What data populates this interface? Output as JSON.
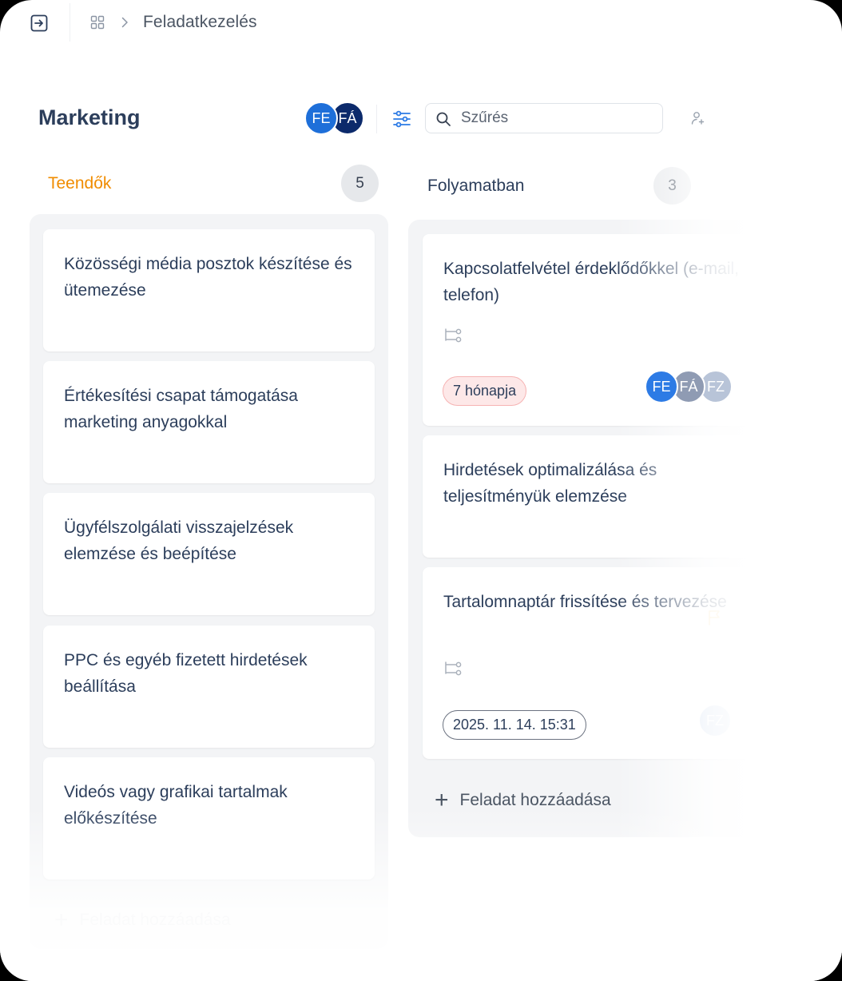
{
  "breadcrumb": {
    "current": "Feladatkezelés"
  },
  "board": {
    "title": "Marketing",
    "members": [
      "FE",
      "FÁ"
    ],
    "search_placeholder": "Szűrés"
  },
  "columns": {
    "todo": {
      "title": "Teendők",
      "count": "5",
      "cards": [
        {
          "title": "Közösségi média posztok készítése és ütemezése"
        },
        {
          "title": "Értékesítési csapat támogatása marketing anyagokkal"
        },
        {
          "title": "Ügyfélszolgálati visszajelzések elemzése és beépítése"
        },
        {
          "title": "PPC és egyéb fizetett hirdetések beállítása"
        },
        {
          "title": "Videós vagy grafikai tartalmak előkészítése"
        }
      ],
      "add_label": "Feladat hozzáadása"
    },
    "in_progress": {
      "title": "Folyamatban",
      "count": "3",
      "cards": [
        {
          "title": "Kapcsolatfelvétel érdeklődőkkel (e-mail, telefon)",
          "tag": "7 hónapja",
          "assignees": [
            "FE",
            "FÁ",
            "FZ"
          ]
        },
        {
          "title": "Hirdetések optimalizálása és teljesítményük elemzése"
        },
        {
          "title": "Tartalomnaptár frissítése és tervezése",
          "tag": "2025. 11. 14. 15:31",
          "assignees": [
            "FZ"
          ]
        }
      ],
      "add_label": "Feladat hozzáadása"
    }
  },
  "colors": {
    "todo_accent": "#f08c00",
    "avatar_fe": "#1e6fd9",
    "avatar_fa": "#0c2a6b",
    "overdue_tag_bg": "#fde8e8"
  },
  "icons": [
    "sidebar-toggle-icon",
    "grid-icon",
    "chevron-right-icon",
    "filter-sliders-icon",
    "search-icon",
    "assign-user-icon",
    "subtask-icon",
    "plus-icon",
    "flag-icon"
  ]
}
